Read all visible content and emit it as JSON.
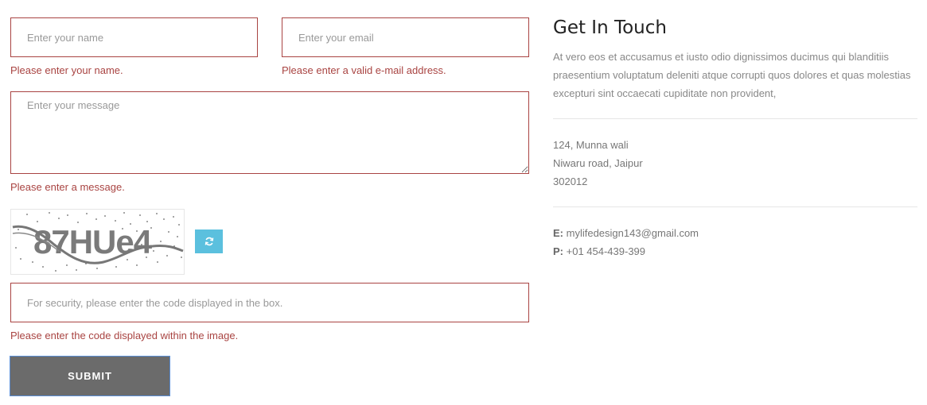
{
  "form": {
    "name_placeholder": "Enter your name",
    "email_placeholder": "Enter your email",
    "message_placeholder": "Enter your message",
    "code_placeholder": "For security, please enter the code displayed in the box.",
    "errors": {
      "name": "Please enter your name.",
      "email": "Please enter a valid e-mail address.",
      "message": "Please enter a message.",
      "code": "Please enter the code displayed within the image."
    },
    "captcha_text": "87HUe4",
    "refresh_icon": "refresh-icon",
    "submit_label": "SUBMIT"
  },
  "contact": {
    "title": "Get In Touch",
    "intro": "At vero eos et accusamus et iusto odio dignissimos ducimus qui blanditiis praesentium voluptatum deleniti atque corrupti quos dolores et quas molestias excepturi sint occaecati cupiditate non provident,",
    "address": [
      "124, Munna wali",
      "Niwaru road, Jaipur",
      "302012"
    ],
    "email_label": "E:",
    "email": "mylifedesign143@gmail.com",
    "phone_label": "P:",
    "phone": "+01 454-439-399"
  },
  "colors": {
    "error": "#a94442",
    "refresh_button": "#5bc0de",
    "submit_button": "#6b6b6b"
  }
}
